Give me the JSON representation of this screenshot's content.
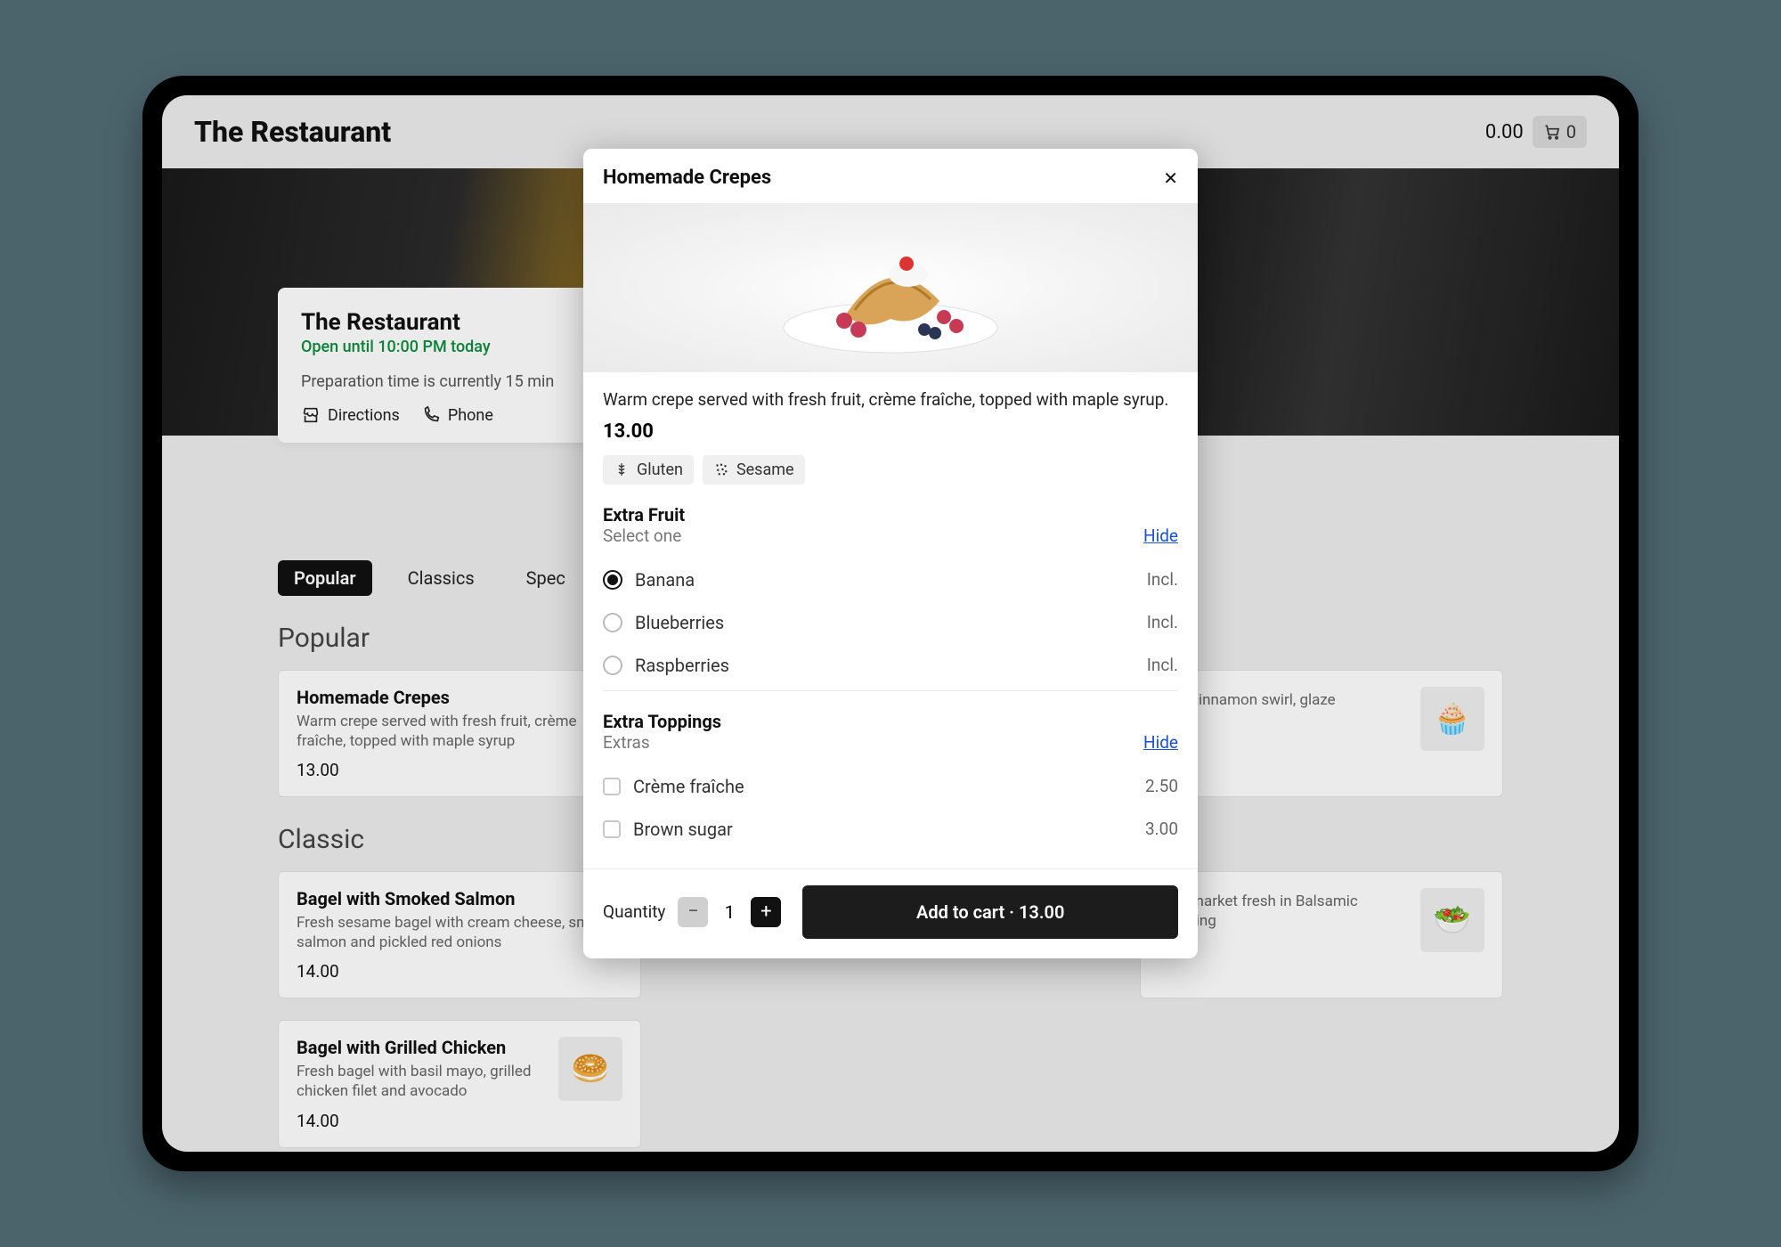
{
  "header": {
    "brand": "The Restaurant",
    "cart_total": "0.00",
    "cart_count": "0"
  },
  "info": {
    "name": "The Restaurant",
    "open_status": "Open until 10:00 PM today",
    "prep": "Preparation time is currently 15 min",
    "directions_label": "Directions",
    "phone_label": "Phone"
  },
  "tabs": [
    "Popular",
    "Classics",
    "Spec"
  ],
  "active_tab": "Popular",
  "sections": [
    {
      "title": "Popular",
      "items": [
        {
          "name": "Homemade Crepes",
          "desc": "Warm crepe served with fresh fruit, crème fraîche, topped with maple syrup",
          "price": "13.00",
          "thumb_label": "crepes"
        },
        {
          "name": "",
          "desc": "with cinnamon swirl, glaze",
          "price": "",
          "thumb_label": "cinnamon-roll"
        }
      ]
    },
    {
      "title": "Classic",
      "items": [
        {
          "name": "Bagel with Smoked Salmon",
          "desc": "Fresh sesame bagel with cream cheese, smoked salmon and pickled red onions",
          "price": "14.00",
          "thumb_label": "salmon-bagel"
        },
        {
          "name": "",
          "desc": "with market fresh in Balsamic dressing",
          "price": "",
          "thumb_label": "salad"
        },
        {
          "name": "Bagel with Grilled Chicken",
          "desc": "Fresh bagel with basil mayo, grilled chicken filet and avocado",
          "price": "14.00",
          "thumb_label": "chicken-bagel"
        }
      ]
    }
  ],
  "modal": {
    "title": "Homemade Crepes",
    "description": "Warm crepe served with fresh fruit, crème fraîche, topped with maple syrup.",
    "price": "13.00",
    "allergens": [
      "Gluten",
      "Sesame"
    ],
    "hide_label": "Hide",
    "groups": [
      {
        "title": "Extra Fruit",
        "subtitle": "Select one",
        "type": "radio",
        "options": [
          {
            "label": "Banana",
            "price": "Incl.",
            "checked": true
          },
          {
            "label": "Blueberries",
            "price": "Incl.",
            "checked": false
          },
          {
            "label": "Raspberries",
            "price": "Incl.",
            "checked": false
          }
        ]
      },
      {
        "title": "Extra Toppings",
        "subtitle": "Extras",
        "type": "checkbox",
        "options": [
          {
            "label": "Crème fraîche",
            "price": "2.50",
            "checked": false
          },
          {
            "label": "Brown sugar",
            "price": "3.00",
            "checked": false
          }
        ]
      }
    ],
    "quantity_label": "Quantity",
    "quantity": "1",
    "add_button": "Add to cart · 13.00"
  }
}
